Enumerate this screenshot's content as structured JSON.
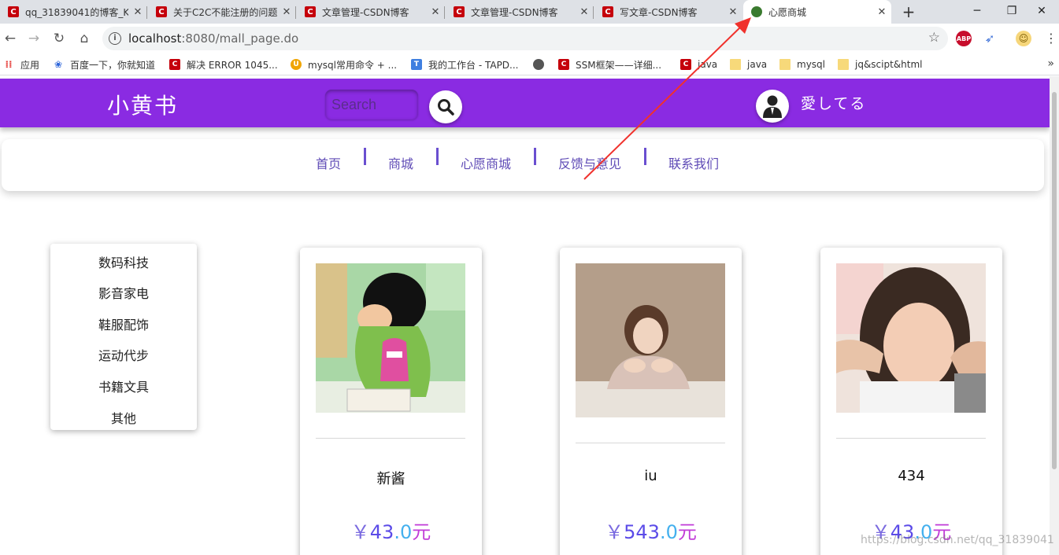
{
  "browser": {
    "tabs": [
      {
        "title": "qq_31839041的博客_K",
        "favicon": "csdn",
        "active": false
      },
      {
        "title": "关于C2C不能注册的问题",
        "favicon": "csdn",
        "active": false
      },
      {
        "title": "文章管理-CSDN博客",
        "favicon": "csdn",
        "active": false
      },
      {
        "title": "文章管理-CSDN博客",
        "favicon": "csdn",
        "active": false
      },
      {
        "title": "写文章-CSDN博客",
        "favicon": "csdn",
        "active": false
      },
      {
        "title": "心愿商城",
        "favicon": "green-logo",
        "active": true
      }
    ],
    "url_host": "localhost",
    "url_rest": ":8080/mall_page.do",
    "bookmarks": [
      {
        "label": "应用",
        "icon": "apps-icon"
      },
      {
        "label": "百度一下，你就知道",
        "icon": "paw-icon"
      },
      {
        "label": "解决 ERROR 1045...",
        "icon": "csdn-icon"
      },
      {
        "label": "mysql常用命令 + ...",
        "icon": "u-icon"
      },
      {
        "label": "我的工作台 - TAPD...",
        "icon": "tapd-icon"
      },
      {
        "label": "SSM框架——详细...",
        "icon": "globe-icon"
      },
      {
        "label": "java",
        "icon": "csdn-icon"
      },
      {
        "label": "java",
        "icon": "folder-icon"
      },
      {
        "label": "mysql",
        "icon": "folder-icon"
      },
      {
        "label": "jq&scipt&html",
        "icon": "folder-icon"
      }
    ],
    "abp_label": "ABP"
  },
  "site": {
    "logo": "小黄书",
    "search_placeholder": "Search",
    "username": "愛してる",
    "nav": [
      "首页",
      "商城",
      "心愿商城",
      "反馈与意见",
      "联系我们"
    ],
    "categories": [
      "数码科技",
      "影音家电",
      "鞋服配饰",
      "运动代步",
      "书籍文具",
      "其他"
    ],
    "products": [
      {
        "name": "新酱",
        "currency": "￥",
        "price_int": "43",
        "price_dec": ".0",
        "unit": "元"
      },
      {
        "name": "iu",
        "currency": "￥",
        "price_int": "543",
        "price_dec": ".0",
        "unit": "元"
      },
      {
        "name": "434",
        "currency": "￥",
        "price_int": "43",
        "price_dec": ".0",
        "unit": "元"
      }
    ],
    "watermark": "https://blog.csdn.net/qq_31839041"
  },
  "colors": {
    "brand": "#8a2be2",
    "nav_text": "#5f4bb6"
  }
}
